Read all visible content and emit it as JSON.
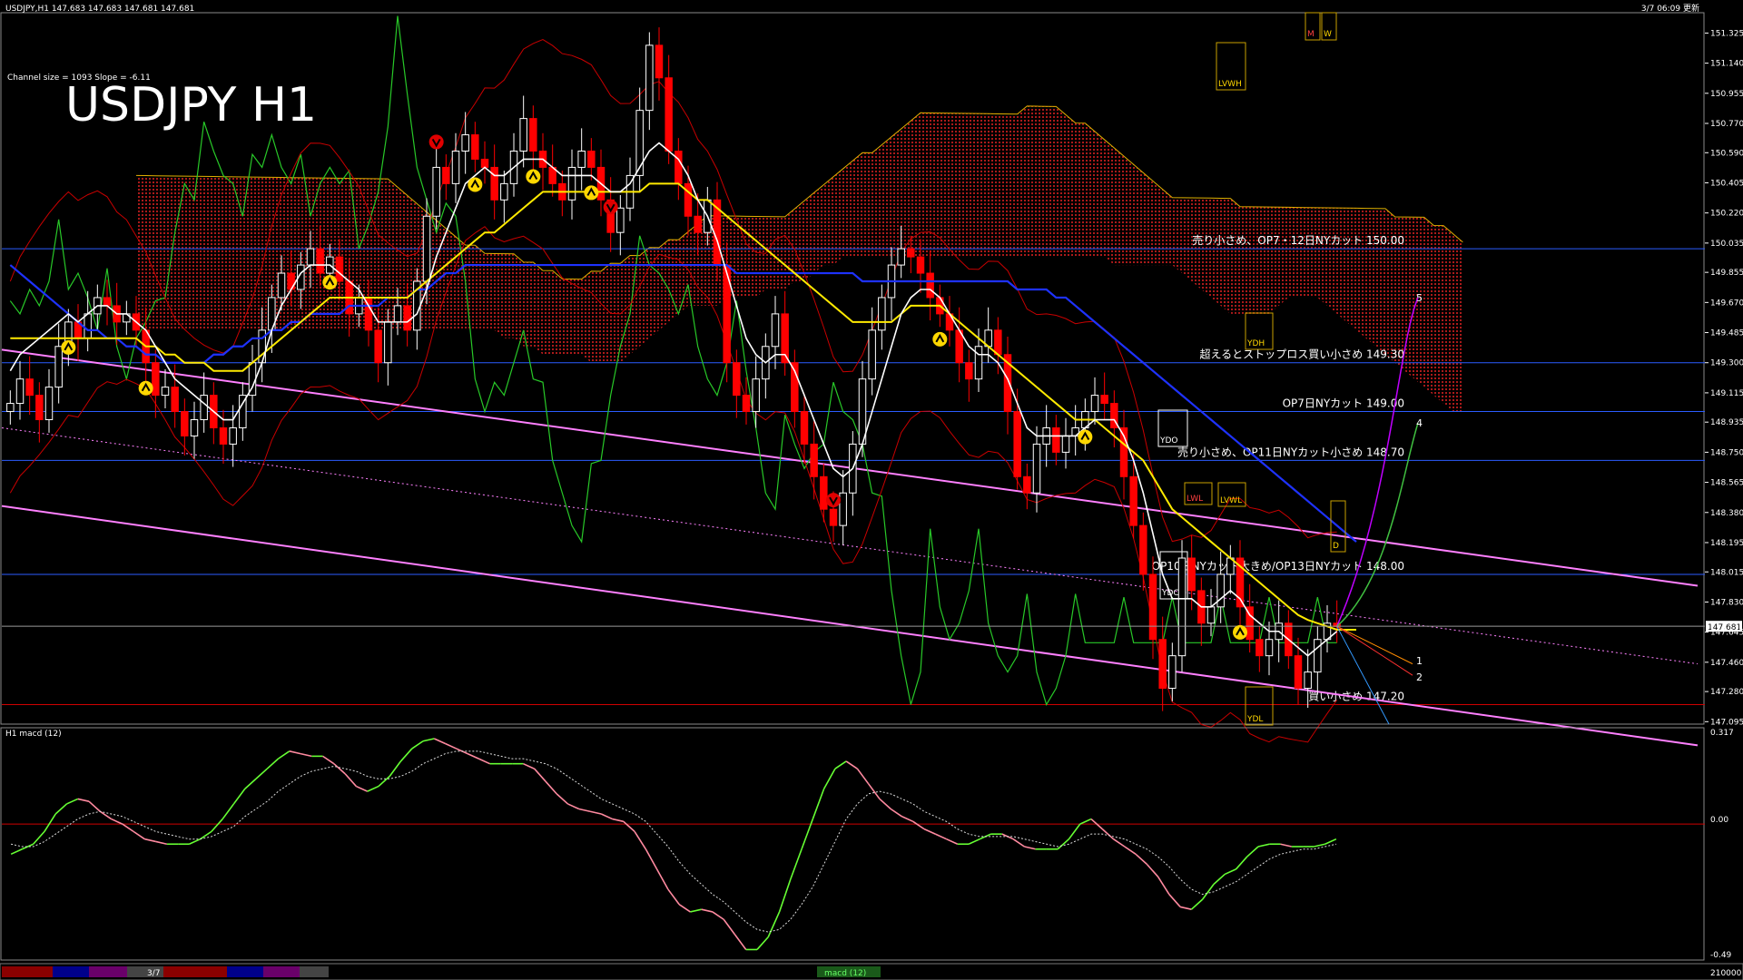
{
  "header": {
    "symbol_info": "USDJPY,H1  147.683 147.683 147.681 147.681",
    "datetime": "3/7 06:09 更新",
    "channel_info": "Channel size = 1093 Slope = -6.11",
    "big_title": "USDJPY H1"
  },
  "macd_panel": {
    "label": "H1 macd (12)",
    "axis_labels": [
      "0.317",
      "0.00",
      "-0.49"
    ]
  },
  "bottom_bar": {
    "date_label": "3/7",
    "indicator_label": "macd (12)",
    "right_value": "210000"
  },
  "colors": {
    "background": "#000000",
    "bull_candle": "#ffffff",
    "bear_candle": "#ff0000",
    "cloud": "#c81e1e",
    "kijun": "#1e32ff",
    "sma_yellow": "#ffea00",
    "sma_white": "#ffffff",
    "chikou": "#28c828",
    "channel": "#ff80ff",
    "macd_up": "#66ff33",
    "macd_down": "#ff8aa0",
    "hline": "#2b5cff"
  },
  "levels": [
    {
      "price": 150.0,
      "text": "売り小さめ、OP7・12日NYカット 150.00"
    },
    {
      "price": 149.3,
      "text": "超えるとストップロス買い小さめ 149.30"
    },
    {
      "price": 149.0,
      "text": "OP7日NYカット 149.00"
    },
    {
      "price": 148.7,
      "text": "売り小さめ、OP11日NYカット小さめ 148.70"
    },
    {
      "price": 148.0,
      "text": "OP10日NYカット大きめ/OP13日NYカット 148.00"
    },
    {
      "price": 147.2,
      "text": "買い小さめ 147.20"
    }
  ],
  "box_labels": [
    "LVWH",
    "YDH",
    "YDO",
    "LWL",
    "LVWL",
    "YDC",
    "YDL",
    "D",
    "M",
    "W"
  ],
  "projection_labels": [
    "1",
    "2",
    "4",
    "5"
  ],
  "current_price": "147.681",
  "chart_data": {
    "type": "line",
    "title": "USDJPY H1",
    "y_axis_ticks": [
      "151.325",
      "151.140",
      "150.955",
      "150.770",
      "150.590",
      "150.405",
      "150.220",
      "150.035",
      "149.855",
      "149.670",
      "149.485",
      "149.300",
      "149.115",
      "148.935",
      "148.750",
      "148.565",
      "148.380",
      "148.195",
      "148.015",
      "147.830",
      "147.645",
      "147.460",
      "147.280",
      "147.095"
    ],
    "ylim": [
      147.08,
      151.45
    ],
    "current_price": 147.681,
    "horizontal_levels": [
      150.0,
      149.3,
      149.0,
      148.7,
      148.0,
      147.2
    ],
    "close_series": {
      "name": "",
      "values": [
        149.05,
        149.2,
        149.1,
        148.95,
        149.15,
        149.4,
        149.55,
        149.45,
        149.6,
        149.7,
        149.65,
        149.55,
        149.6,
        149.5,
        149.3,
        149.1,
        149.15,
        149.0,
        148.85,
        148.95,
        149.1,
        148.9,
        148.8,
        148.9,
        149.1,
        149.3,
        149.5,
        149.7,
        149.85,
        149.75,
        149.9,
        150.0,
        149.85,
        149.95,
        149.8,
        149.6,
        149.7,
        149.5,
        149.3,
        149.55,
        149.65,
        149.5,
        149.8,
        150.2,
        150.5,
        150.4,
        150.6,
        150.7,
        150.55,
        150.5,
        150.3,
        150.4,
        150.6,
        150.8,
        150.6,
        150.5,
        150.4,
        150.3,
        150.5,
        150.6,
        150.5,
        150.3,
        150.1,
        150.25,
        150.45,
        150.85,
        151.25,
        151.05,
        150.6,
        150.4,
        150.2,
        150.1,
        150.3,
        149.9,
        149.3,
        149.1,
        149.0,
        149.2,
        149.4,
        149.6,
        149.3,
        149.0,
        148.8,
        148.6,
        148.4,
        148.3,
        148.5,
        148.8,
        149.2,
        149.5,
        149.7,
        149.9,
        150.0,
        149.95,
        149.85,
        149.7,
        149.6,
        149.5,
        149.3,
        149.2,
        149.4,
        149.5,
        149.35,
        149.0,
        148.6,
        148.5,
        148.8,
        148.9,
        148.75,
        148.85,
        148.9,
        149.0,
        149.1,
        149.05,
        148.9,
        148.6,
        148.3,
        148.0,
        147.6,
        147.3,
        147.5,
        148.1,
        147.9,
        147.7,
        147.8,
        148.0,
        148.1,
        147.8,
        147.6,
        147.5,
        147.6,
        147.7,
        147.5,
        147.3,
        147.4,
        147.6,
        147.7,
        147.68
      ]
    },
    "sma_white": {
      "name": "",
      "values": [
        149.25,
        149.35,
        149.4,
        149.45,
        149.5,
        149.55,
        149.6,
        149.55,
        149.6,
        149.65,
        149.65,
        149.6,
        149.6,
        149.55,
        149.5,
        149.4,
        149.3,
        149.2,
        149.15,
        149.1,
        149.05,
        149.0,
        148.95,
        148.95,
        149.05,
        149.15,
        149.3,
        149.5,
        149.65,
        149.75,
        149.85,
        149.9,
        149.9,
        149.9,
        149.85,
        149.8,
        149.75,
        149.65,
        149.55,
        149.55,
        149.55,
        149.55,
        149.6,
        149.75,
        149.95,
        150.1,
        150.25,
        150.4,
        150.45,
        150.5,
        150.45,
        150.45,
        150.5,
        150.55,
        150.55,
        150.55,
        150.5,
        150.45,
        150.45,
        150.45,
        150.45,
        150.4,
        150.35,
        150.35,
        150.4,
        150.5,
        150.6,
        150.65,
        150.6,
        150.55,
        150.45,
        150.3,
        150.2,
        150.05,
        149.85,
        149.65,
        149.45,
        149.35,
        149.3,
        149.35,
        149.35,
        149.25,
        149.1,
        148.95,
        148.8,
        148.65,
        148.6,
        148.65,
        148.8,
        149.0,
        149.2,
        149.4,
        149.6,
        149.7,
        149.75,
        149.75,
        149.7,
        149.6,
        149.5,
        149.4,
        149.35,
        149.35,
        149.3,
        149.2,
        149.05,
        148.9,
        148.85,
        148.85,
        148.85,
        148.85,
        148.85,
        148.9,
        148.95,
        148.95,
        148.95,
        148.85,
        148.7,
        148.5,
        148.25,
        148.0,
        147.85,
        147.85,
        147.85,
        147.8,
        147.8,
        147.85,
        147.9,
        147.85,
        147.75,
        147.7,
        147.65,
        147.65,
        147.6,
        147.55,
        147.5,
        147.55,
        147.6,
        147.65
      ]
    },
    "sma_yellow": {
      "name": "",
      "values": [
        149.45,
        149.45,
        149.45,
        149.45,
        149.45,
        149.45,
        149.45,
        149.45,
        149.45,
        149.45,
        149.45,
        149.45,
        149.45,
        149.45,
        149.4,
        149.4,
        149.35,
        149.35,
        149.3,
        149.3,
        149.3,
        149.25,
        149.25,
        149.25,
        149.25,
        149.3,
        149.35,
        149.4,
        149.45,
        149.5,
        149.55,
        149.6,
        149.65,
        149.7,
        149.7,
        149.7,
        149.7,
        149.7,
        149.7,
        149.7,
        149.7,
        149.7,
        149.75,
        149.8,
        149.85,
        149.9,
        149.95,
        150.0,
        150.05,
        150.1,
        150.1,
        150.15,
        150.2,
        150.25,
        150.3,
        150.35,
        150.35,
        150.35,
        150.35,
        150.35,
        150.35,
        150.35,
        150.35,
        150.35,
        150.35,
        150.35,
        150.4,
        150.4,
        150.4,
        150.4,
        150.35,
        150.3,
        150.3,
        150.25,
        150.2,
        150.15,
        150.1,
        150.05,
        150.0,
        149.95,
        149.9,
        149.85,
        149.8,
        149.75,
        149.7,
        149.65,
        149.6,
        149.55,
        149.55,
        149.55,
        149.55,
        149.55,
        149.6,
        149.65,
        149.65,
        149.65,
        149.65,
        149.6,
        149.55,
        149.5,
        149.45,
        149.4,
        149.35,
        149.3,
        149.25,
        149.2,
        149.15,
        149.1,
        149.05,
        149.0,
        148.95,
        148.95,
        148.95,
        148.9,
        148.85,
        148.8,
        148.75,
        148.7,
        148.6,
        148.5,
        148.4,
        148.35,
        148.3,
        148.25,
        148.2,
        148.15,
        148.1,
        148.05,
        148.0,
        147.95,
        147.9,
        147.85,
        147.8,
        147.75,
        147.72,
        147.7,
        147.68,
        147.66,
        147.66,
        147.66
      ]
    },
    "kijun_blue": {
      "name": "",
      "values": [
        149.9,
        149.85,
        149.8,
        149.75,
        149.7,
        149.65,
        149.6,
        149.55,
        149.5,
        149.5,
        149.45,
        149.45,
        149.4,
        149.4,
        149.35,
        149.35,
        149.3,
        149.3,
        149.3,
        149.3,
        149.3,
        149.35,
        149.35,
        149.4,
        149.4,
        149.45,
        149.45,
        149.5,
        149.5,
        149.55,
        149.55,
        149.6,
        149.6,
        149.6,
        149.6,
        149.65,
        149.65,
        149.65,
        149.65,
        149.7,
        149.7,
        149.7,
        149.75,
        149.75,
        149.8,
        149.85,
        149.85,
        149.9,
        149.9,
        149.9,
        149.9,
        149.9,
        149.9,
        149.9,
        149.9,
        149.9,
        149.9,
        149.9,
        149.9,
        149.9,
        149.9,
        149.9,
        149.9,
        149.9,
        149.9,
        149.9,
        149.9,
        149.9,
        149.9,
        149.9,
        149.9,
        149.9,
        149.9,
        149.9,
        149.9,
        149.85,
        149.85,
        149.85,
        149.85,
        149.85,
        149.85,
        149.85,
        149.85,
        149.85,
        149.85,
        149.85,
        149.85,
        149.85,
        149.8,
        149.8,
        149.8,
        149.8,
        149.8,
        149.8,
        149.8,
        149.8,
        149.8,
        149.8,
        149.8,
        149.8,
        149.8,
        149.8,
        149.8,
        149.8,
        149.75,
        149.75,
        149.75,
        149.75,
        149.7,
        149.7,
        149.65,
        149.6,
        149.55,
        149.5,
        149.45,
        149.4,
        149.35,
        149.3,
        149.25,
        149.2,
        149.15,
        149.1,
        149.05,
        149.0,
        148.95,
        148.9,
        148.85,
        148.8,
        148.75,
        148.7,
        148.65,
        148.6,
        148.55,
        148.5,
        148.45,
        148.4,
        148.35,
        148.3,
        148.25,
        148.2
      ]
    },
    "macd": {
      "name": "",
      "values": [
        -0.12,
        -0.1,
        -0.08,
        -0.03,
        0.04,
        0.08,
        0.1,
        0.09,
        0.05,
        0.02,
        0.0,
        -0.03,
        -0.06,
        -0.07,
        -0.08,
        -0.08,
        -0.08,
        -0.06,
        -0.03,
        0.02,
        0.08,
        0.14,
        0.18,
        0.22,
        0.26,
        0.29,
        0.28,
        0.27,
        0.27,
        0.24,
        0.2,
        0.15,
        0.13,
        0.15,
        0.19,
        0.25,
        0.3,
        0.33,
        0.34,
        0.32,
        0.3,
        0.28,
        0.26,
        0.24,
        0.24,
        0.24,
        0.24,
        0.22,
        0.17,
        0.12,
        0.08,
        0.06,
        0.05,
        0.04,
        0.02,
        0.01,
        -0.03,
        -0.1,
        -0.18,
        -0.26,
        -0.32,
        -0.35,
        -0.34,
        -0.35,
        -0.38,
        -0.44,
        -0.5,
        -0.5,
        -0.45,
        -0.35,
        -0.22,
        -0.1,
        0.02,
        0.14,
        0.22,
        0.25,
        0.22,
        0.16,
        0.1,
        0.06,
        0.03,
        0.01,
        -0.02,
        -0.04,
        -0.06,
        -0.08,
        -0.08,
        -0.06,
        -0.04,
        -0.04,
        -0.06,
        -0.09,
        -0.1,
        -0.1,
        -0.1,
        -0.06,
        0.0,
        0.02,
        -0.02,
        -0.06,
        -0.09,
        -0.12,
        -0.16,
        -0.21,
        -0.28,
        -0.33,
        -0.34,
        -0.3,
        -0.24,
        -0.2,
        -0.18,
        -0.13,
        -0.09,
        -0.08,
        -0.08,
        -0.09,
        -0.09,
        -0.09,
        -0.08,
        -0.06
      ]
    },
    "macd_signal": {
      "name": "",
      "values": [
        -0.08,
        -0.09,
        -0.09,
        -0.07,
        -0.04,
        -0.01,
        0.02,
        0.04,
        0.05,
        0.04,
        0.03,
        0.01,
        -0.01,
        -0.03,
        -0.04,
        -0.05,
        -0.06,
        -0.06,
        -0.05,
        -0.03,
        -0.01,
        0.03,
        0.06,
        0.09,
        0.13,
        0.16,
        0.19,
        0.21,
        0.22,
        0.23,
        0.22,
        0.21,
        0.19,
        0.18,
        0.18,
        0.19,
        0.21,
        0.24,
        0.26,
        0.28,
        0.29,
        0.29,
        0.29,
        0.28,
        0.27,
        0.26,
        0.26,
        0.25,
        0.24,
        0.22,
        0.19,
        0.16,
        0.13,
        0.1,
        0.08,
        0.06,
        0.04,
        0.01,
        -0.04,
        -0.09,
        -0.15,
        -0.2,
        -0.24,
        -0.28,
        -0.31,
        -0.35,
        -0.39,
        -0.42,
        -0.43,
        -0.42,
        -0.38,
        -0.32,
        -0.25,
        -0.16,
        -0.07,
        0.02,
        0.08,
        0.12,
        0.13,
        0.12,
        0.1,
        0.08,
        0.05,
        0.03,
        0.01,
        -0.02,
        -0.04,
        -0.05,
        -0.05,
        -0.05,
        -0.05,
        -0.06,
        -0.07,
        -0.08,
        -0.09,
        -0.08,
        -0.06,
        -0.04,
        -0.04,
        -0.05,
        -0.06,
        -0.08,
        -0.1,
        -0.13,
        -0.17,
        -0.22,
        -0.26,
        -0.28,
        -0.27,
        -0.25,
        -0.23,
        -0.2,
        -0.17,
        -0.14,
        -0.12,
        -0.11,
        -0.1,
        -0.1,
        -0.09,
        -0.08
      ],
      "ylim": [
        -0.52,
        0.34
      ]
    }
  }
}
